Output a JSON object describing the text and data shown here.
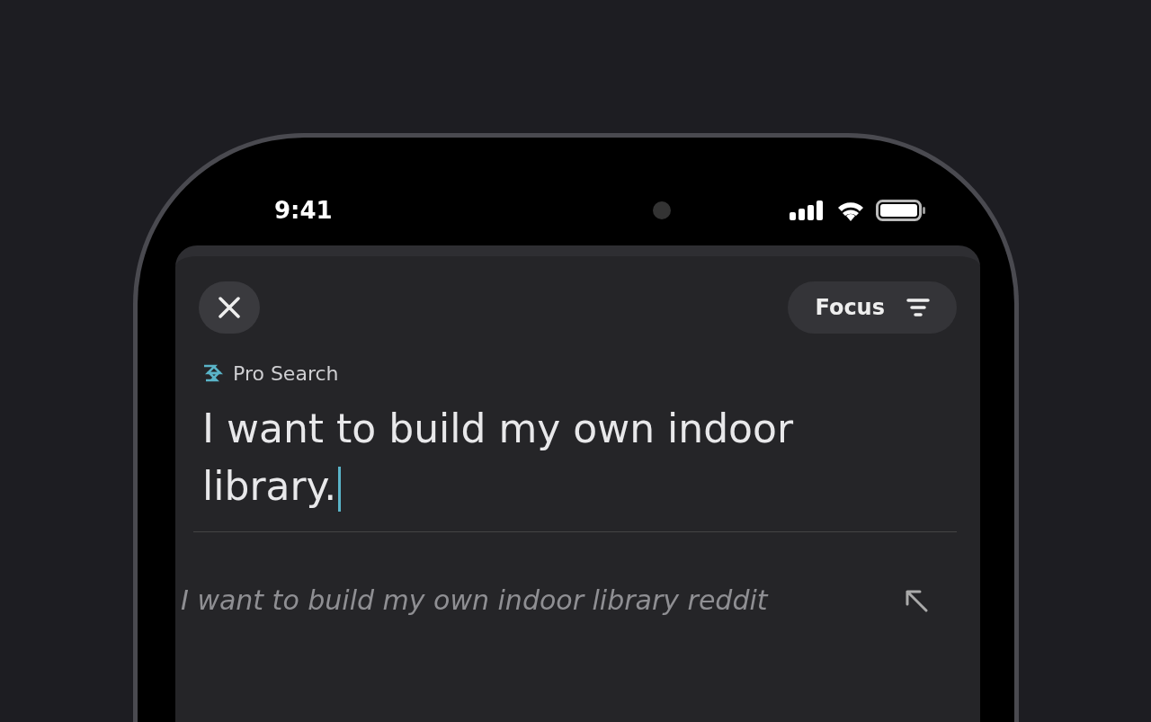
{
  "status_bar": {
    "time": "9:41"
  },
  "toolbar": {
    "focus_button": "Focus"
  },
  "mode": {
    "label": "Pro Search"
  },
  "query": {
    "value": "I want to build my own indoor library."
  },
  "suggestions": [
    {
      "text": "I want to build my own indoor library reddit"
    }
  ]
}
